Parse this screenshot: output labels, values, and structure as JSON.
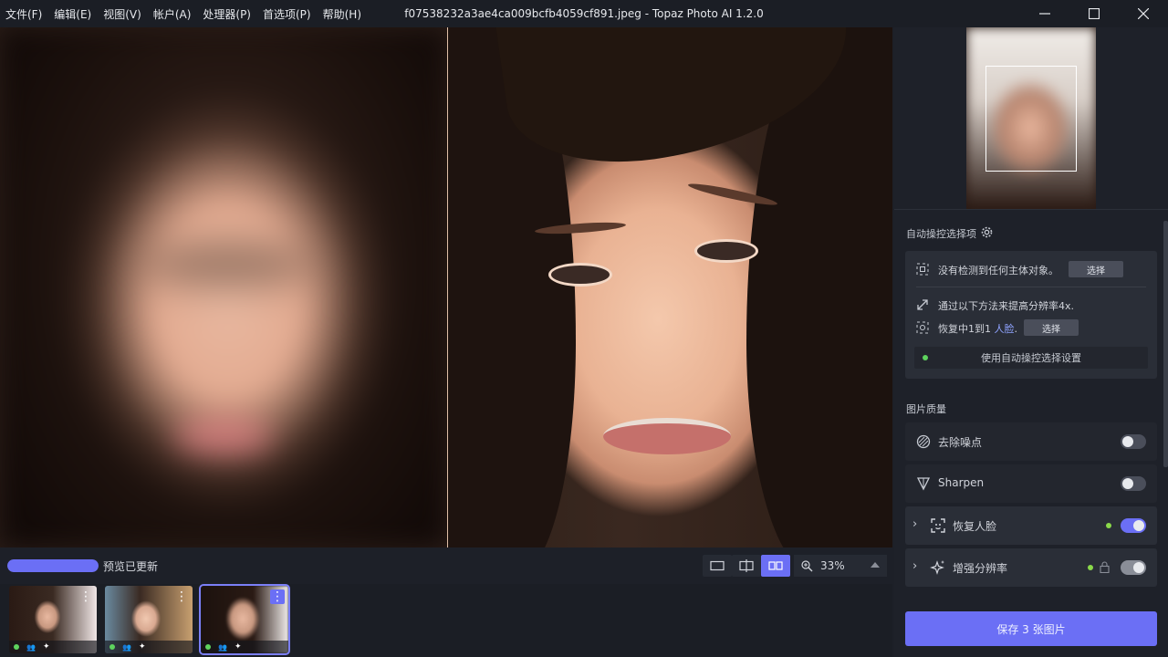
{
  "menu": [
    "文件(F)",
    "编辑(E)",
    "视图(V)",
    "帐户(A)",
    "处理器(P)",
    "首选项(P)",
    "帮助(H)"
  ],
  "window": {
    "title": "f07538232a3ae4ca009bcfb4059cf891.jpeg - Topaz Photo AI 1.2.0"
  },
  "status": {
    "text": "预览已更新",
    "progress": 1.0
  },
  "zoom": {
    "value": "33%"
  },
  "autopilot": {
    "title": "自动操控选择项",
    "subject_text": "没有检测到任何主体对象。",
    "subject_button": "选择",
    "upscale_text": "通过以下方法来提高分辨率4x.",
    "face_prefix": "恢复中1到1 ",
    "face_link": "人脸",
    "face_suffix": ".",
    "face_button": "选择",
    "use_settings": "使用自动操控选择设置"
  },
  "quality": {
    "title": "图片质量",
    "features": [
      {
        "label": "去除噪点",
        "enabled": false
      },
      {
        "label": "Sharpen",
        "enabled": false
      },
      {
        "label": "恢复人脸",
        "enabled": true
      },
      {
        "label": "增强分辨率",
        "enabled": true,
        "locked": true
      }
    ]
  },
  "save_button": "保存 3 张图片",
  "colors": {
    "accent": "#6b6ff5",
    "status_dot": "#5ed35e"
  }
}
